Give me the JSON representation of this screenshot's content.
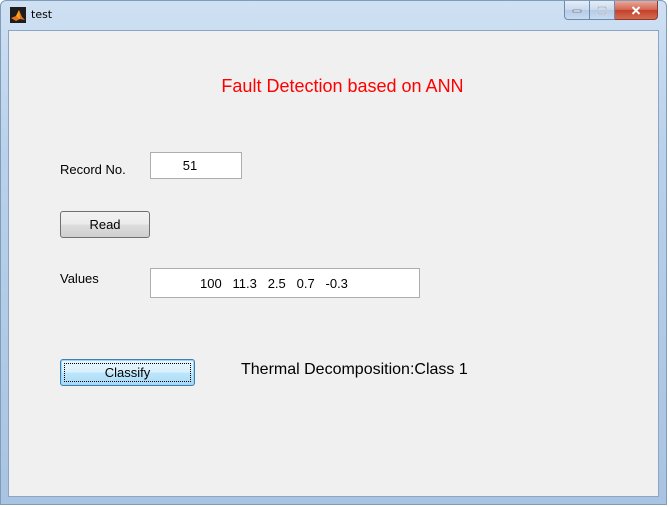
{
  "window": {
    "title": "test",
    "caption_buttons": {
      "minimize_icon": "minimize-icon",
      "maximize_icon": "maximize-icon",
      "close_icon": "close-icon"
    }
  },
  "heading": {
    "text": "Fault Detection based on ANN",
    "color": "#ff0000"
  },
  "record": {
    "label": "Record No.",
    "value": "51"
  },
  "read_button": {
    "label": "Read"
  },
  "values": {
    "label": "Values",
    "value": "100   11.3   2.5   0.7   -0.3"
  },
  "classify_button": {
    "label": "Classify"
  },
  "result": {
    "text": "Thermal Decomposition:Class 1"
  },
  "colors": {
    "client_background": "#f0f0f0",
    "heading": "#ff0000",
    "focused_button_border": "#3c7fb1"
  }
}
